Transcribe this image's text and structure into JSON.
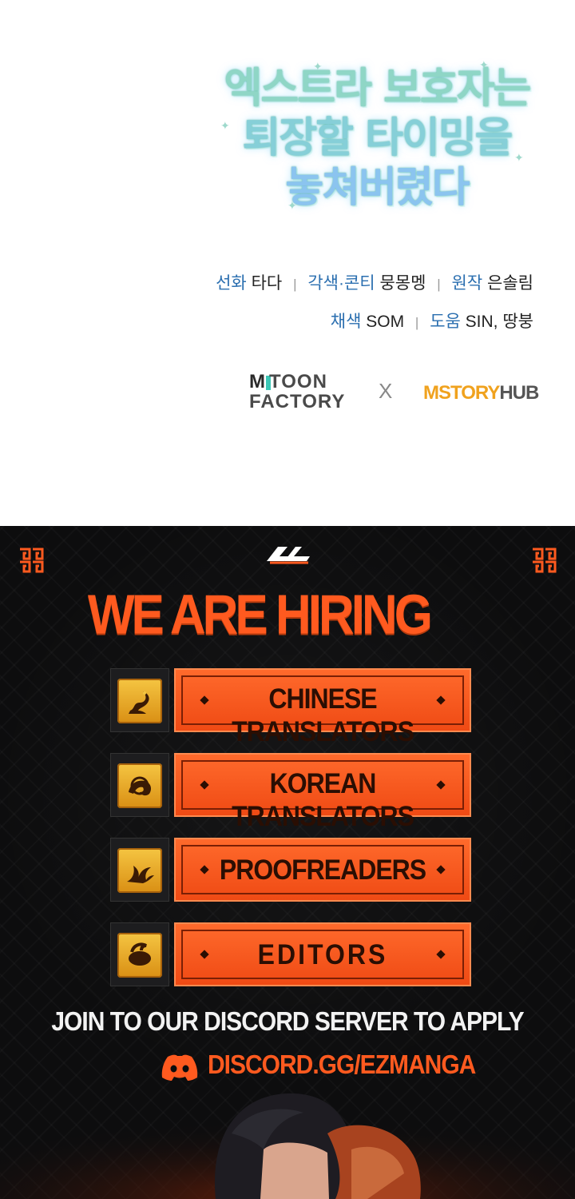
{
  "top": {
    "title_lines": [
      "엑스트라 보호자는",
      "퇴장할 타이밍을",
      "놓쳐버렸다"
    ],
    "credits": {
      "line1": [
        {
          "role": "선화",
          "name": "타다"
        },
        {
          "role": "각색·콘티",
          "name": "뭉몽멩"
        },
        {
          "role": "원작",
          "name": "은솔림"
        }
      ],
      "line2": [
        {
          "role": "채색",
          "name": "SOM"
        },
        {
          "role": "도움",
          "name": "SIN, 땅붕"
        }
      ],
      "separator": "|"
    },
    "logos": {
      "mtoon_m": "M",
      "mtoon_rest": "TOON",
      "mtoon_line2": "FACTORY",
      "cross": "X",
      "mstory": "MSTORY",
      "hub": "HUB"
    }
  },
  "recruit": {
    "headline": "WE ARE HIRING",
    "roles": [
      {
        "label": "CHINESE TRANSLATORS",
        "icon": "dragon-emblem-icon"
      },
      {
        "label": "KOREAN TRANSLATORS",
        "icon": "tiger-emblem-icon"
      },
      {
        "label": "PROOFREADERS",
        "icon": "phoenix-emblem-icon"
      },
      {
        "label": "EDITORS",
        "icon": "turtle-emblem-icon"
      }
    ],
    "cta": "JOIN TO OUR  DISCORD SERVER TO APPLY",
    "discord_link": "DISCORD.GG/EZMANGA",
    "colors": {
      "accent": "#ff5a1f",
      "button": "#f05a1e",
      "emblem": "#f0b531",
      "background": "#0d0d0e"
    }
  }
}
